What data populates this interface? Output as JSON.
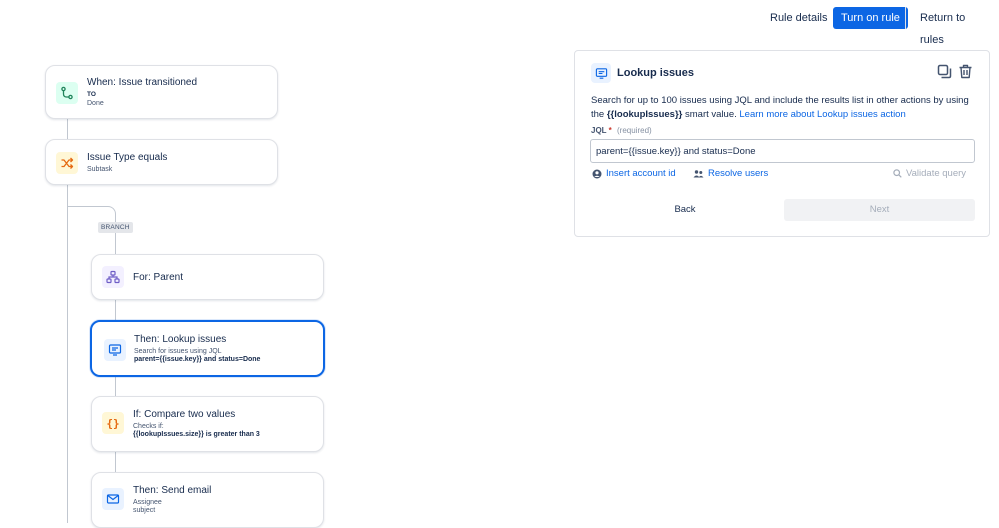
{
  "topbar": {
    "rule_details": "Rule details",
    "turn_on": "Turn on rule",
    "return": "Return to rules"
  },
  "flow": {
    "trigger": {
      "title": "When: Issue transitioned",
      "sub_label": "TO",
      "sub_value": "Done",
      "icon": "transition-icon"
    },
    "condition": {
      "title": "Issue Type equals",
      "sub": "Subtask",
      "icon": "shuffle-icon"
    },
    "branch_tag": "BRANCH",
    "branch": {
      "title": "For: Parent",
      "icon": "hierarchy-icon"
    },
    "lookup": {
      "title": "Then: Lookup issues",
      "sub": "Search for issues using JQL",
      "query": "parent={{issue.key}} and status=Done",
      "icon": "lookup-icon"
    },
    "compare": {
      "title": "If: Compare two values",
      "sub": "Checks if:",
      "expr": "{{lookupIssues.size}} is greater than 3",
      "icon": "braces-icon"
    },
    "email": {
      "title": "Then: Send email",
      "sub1": "Assignee",
      "sub2": "subject",
      "icon": "mail-icon"
    }
  },
  "panel": {
    "title": "Lookup issues",
    "desc_1": "Search for up to 100 issues using JQL and include the results list in other actions by using the ",
    "smart_value": "{{lookupIssues}}",
    "desc_2": " smart value. ",
    "learn_more": "Learn more about Lookup issues action",
    "jql_label": "JQL",
    "required_mark": "*",
    "required_hint": "(required)",
    "jql_value": "parent={{issue.key}} and status=Done",
    "insert_account": "Insert account id",
    "resolve_users": "Resolve users",
    "validate": "Validate query",
    "back": "Back",
    "next": "Next"
  },
  "colors": {
    "primary": "#0c66e4",
    "trigger_bg": "#dcfff1",
    "trigger_fg": "#1f845a",
    "condition_bg": "#fff7d6",
    "condition_fg": "#e56910",
    "branch_bg": "#f3f0ff",
    "branch_fg": "#6e5dc6",
    "action_bg": "#e9f2ff",
    "action_fg": "#0c66e4"
  }
}
